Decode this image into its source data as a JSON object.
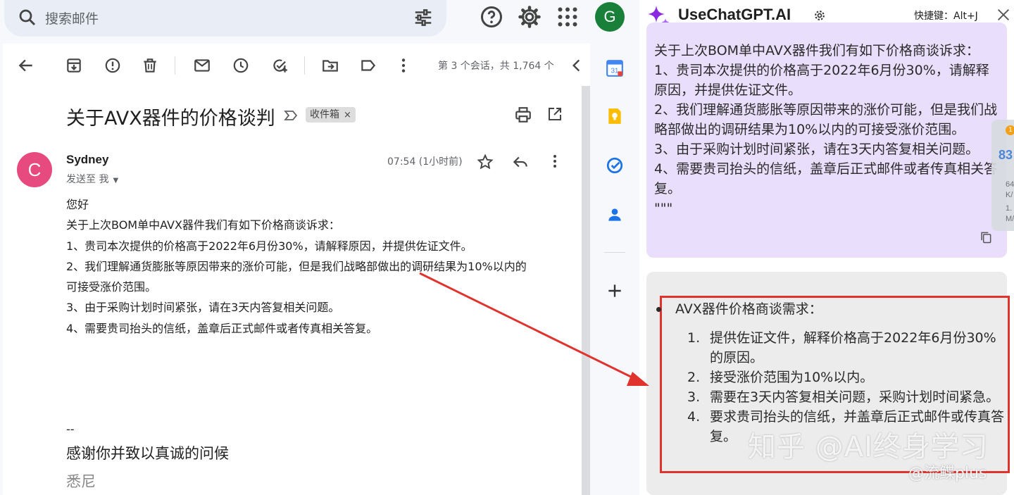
{
  "gmail": {
    "search_placeholder": "搜索邮件",
    "account_initial": "G",
    "pager": "第 3 个会话，共 1,764 个",
    "subject": "关于AVX器件的价格谈判",
    "label": "收件箱",
    "label_remove": "×",
    "sender": {
      "initial": "C",
      "name": "Sydney",
      "sent_to": "发送至 我",
      "time": "07:54 (1小时前)"
    },
    "body_lines": [
      "您好",
      "关于上次BOM单中AVX器件我们有如下价格商谈诉求：",
      "1、贵司本次提供的价格高于2022年6月份30%，请解释原因，并提供佐证文件。",
      "2、我们理解通货膨胀等原因带来的涨价可能，但是我们战略部做出的调研结果为10%以内的",
      "可接受涨价范围。",
      "3、由于采购计划时间紧张，请在3天内答复相关问题。",
      "4、需要贵司抬头的信纸，盖章后正式邮件或者传真相关答复。"
    ],
    "signature_dash": "--",
    "signature_line1": "感谢你并致以真诚的问候",
    "signature_line2": "悉尼"
  },
  "rail": {
    "calendar_day": "31"
  },
  "chatgpt": {
    "title": "UseChatGPT.AI",
    "shortcut": "快捷键：Alt+J",
    "user_text": "关于上次BOM单中AVX器件我们有如下价格商谈诉求：\n1、贵司本次提供的价格高于2022年6月份30%，请解释原因，并提供佐证文件。\n2、我们理解通货膨胀等原因带来的涨价可能，但是我们战略部做出的调研结果为10%以内的可接受涨价范围。\n3、由于采购计划时间紧张，请在3天内答复相关问题。\n4、需要贵司抬头的信纸，盖章后正式邮件或者传真相关答复。\n\"\"\"",
    "ai_bullet": "AVX器件价格商谈需求：",
    "ai_items": [
      {
        "num": "1.",
        "text": "提供佐证文件，解释价格高于2022年6月份30%的原因。"
      },
      {
        "num": "2.",
        "text": "接受涨价范围为10%以内。"
      },
      {
        "num": "3.",
        "text": "需要在3天内答复相关问题，采购计划时间紧急。"
      },
      {
        "num": "4.",
        "text": "要求贵司抬头的信纸，并盖章后正式邮件或传真答复。"
      }
    ]
  },
  "widget": {
    "badge": "1",
    "big": "83",
    "up": "64",
    "up_unit": "K/",
    "down": "1.",
    "down_unit": "M/"
  },
  "watermark": {
    "line1": "知乎 @AI终身学习",
    "line2": "@流鲽plus"
  },
  "colors": {
    "accent_red": "#e0332e",
    "gmail_green": "#188038",
    "sender_pink": "#e64a7f",
    "chat_user_bg": "#e9dffc"
  }
}
